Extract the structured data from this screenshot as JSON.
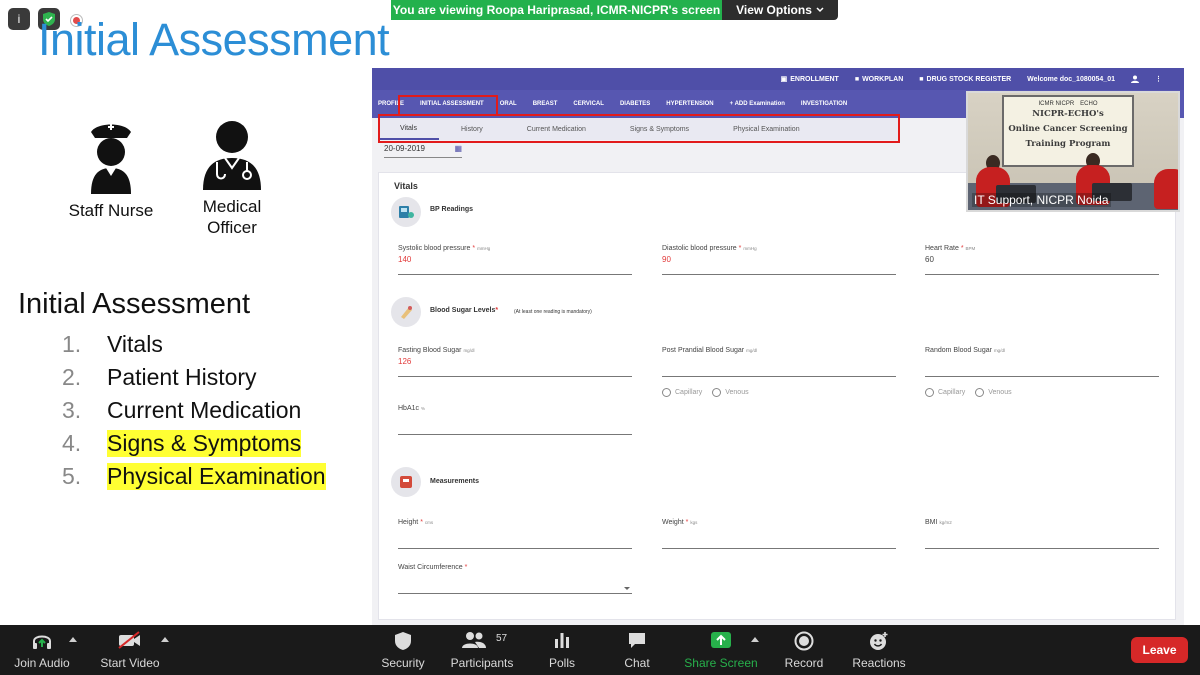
{
  "banner": {
    "viewing_text": "You are viewing Roopa Hariprasad, ICMR-NICPR's screen",
    "view_options": "View Options"
  },
  "top_indicators": {
    "info": "i"
  },
  "slide": {
    "title": "Initial Assessment",
    "roles": [
      {
        "label": "Staff Nurse",
        "icon": "nurse-icon"
      },
      {
        "label": "Medical Officer",
        "icon": "doctor-icon"
      }
    ],
    "assessment_heading": "Initial Assessment",
    "items": [
      {
        "num": "1.",
        "text": "Vitals",
        "highlighted": false
      },
      {
        "num": "2.",
        "text": "Patient History",
        "highlighted": false
      },
      {
        "num": "3.",
        "text": "Current Medication",
        "highlighted": false
      },
      {
        "num": "4.",
        "text": "Signs & Symptoms",
        "highlighted": true
      },
      {
        "num": "5.",
        "text": "Physical Examination",
        "highlighted": true
      }
    ],
    "highlight_color": "#ffff33",
    "title_color": "#2c8ed6"
  },
  "app": {
    "top_bar": {
      "enrollment": "ENROLLMENT",
      "workplan": "WORKPLAN",
      "drug_stock": "DRUG STOCK REGISTER",
      "welcome": "Welcome doc_1080054_01"
    },
    "nav": [
      "PROFILE",
      "INITIAL ASSESSMENT",
      "ORAL",
      "BREAST",
      "CERVICAL",
      "DIABETES",
      "HYPERTENSION",
      "+ ADD Examination",
      "INVESTIGATION"
    ],
    "subtabs": [
      "Vitals",
      "History",
      "Current Medication",
      "Signs & Symptoms",
      "Physical Examination"
    ],
    "date": "20-09-2019",
    "vitals_title": "Vitals",
    "bp": {
      "title": "BP Readings",
      "systolic_label": "Systolic blood pressure",
      "systolic_unit": "mmHg",
      "systolic_value": "140",
      "diastolic_label": "Diastolic blood pressure",
      "diastolic_unit": "mmHg",
      "diastolic_value": "90",
      "heart_label": "Heart Rate",
      "heart_unit": "BPM",
      "heart_value": "60"
    },
    "sugar": {
      "title": "Blood Sugar Levels",
      "note": "(At least one reading is mandatory)",
      "fasting_label": "Fasting Blood Sugar",
      "fasting_unit": "mg/dl",
      "fasting_value": "126",
      "pp_label": "Post Prandial Blood Sugar",
      "pp_unit": "mg/dl",
      "random_label": "Random Blood Sugar",
      "random_unit": "mg/dl",
      "capillary": "Capillary",
      "venous": "Venous",
      "hba1c_label": "HbA1c",
      "hba1c_unit": "%"
    },
    "measurements": {
      "title": "Measurements",
      "height_label": "Height",
      "height_unit": "cms",
      "weight_label": "Weight",
      "weight_unit": "kgs",
      "bmi_label": "BMI",
      "bmi_unit": "kg/m2",
      "waist_label": "Waist Circumference"
    },
    "primary_color": "#4f4fa8"
  },
  "video": {
    "board_logos": [
      "ICMR NICPR",
      "ECHO"
    ],
    "board_lines": [
      "NICPR-ECHO's",
      "Online Cancer Screening",
      "Training Program"
    ],
    "label": "IT Support, NICPR Noida"
  },
  "toolbar": {
    "join_audio": "Join Audio",
    "start_video": "Start Video",
    "security": "Security",
    "participants": "Participants",
    "participants_count": "57",
    "polls": "Polls",
    "chat": "Chat",
    "share_screen": "Share Screen",
    "record": "Record",
    "reactions": "Reactions",
    "leave": "Leave"
  }
}
